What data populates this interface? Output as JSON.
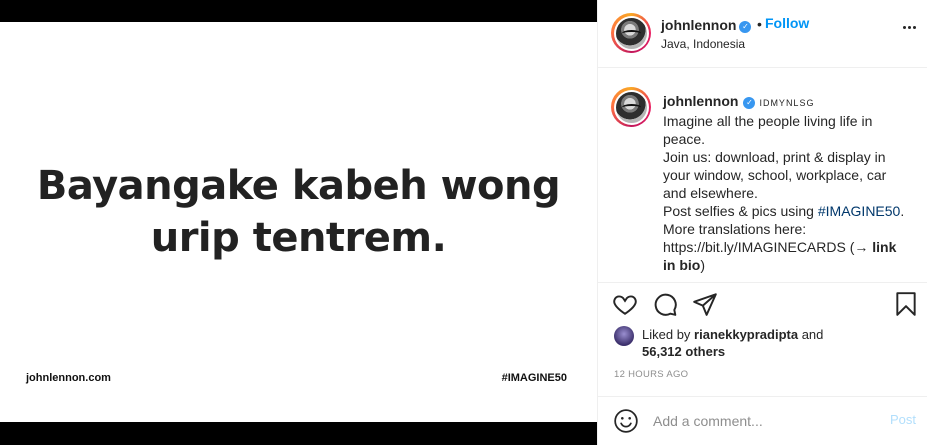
{
  "media": {
    "headline_line1": "Bayangake kabeh wong",
    "headline_line2": "urip tentrem.",
    "footer_left": "johnlennon.com",
    "footer_right": "#IMAGINE50"
  },
  "header": {
    "username": "johnlennon",
    "verified_icon": "verified-badge-icon",
    "separator": "•",
    "follow_label": "Follow",
    "location": "Java, Indonesia"
  },
  "caption": {
    "username": "johnlennon",
    "code": "IDMYNLSG",
    "line1": "Imagine all the people living life in",
    "line2": "peace.",
    "line3": "Join us: download, print & display in",
    "line4": "your window, school, workplace, car",
    "line5": "and elsewhere.",
    "line6_prefix": "Post selfies & pics using ",
    "line6_hashtag": "#IMAGINE50",
    "line6_suffix": ".",
    "line7": "More translations here:",
    "line8_prefix": "https://bit.ly/IMAGINECARDS (→ ",
    "line8_bold": "link",
    "line9_bold": "in bio",
    "line9_suffix": ")"
  },
  "likes": {
    "prefix": "Liked by ",
    "user": "rianekkypradipta",
    "suffix": " and",
    "count": "56,312 others"
  },
  "timestamp": "12 HOURS AGO",
  "comment": {
    "placeholder": "Add a comment...",
    "post_label": "Post"
  },
  "colors": {
    "accent": "#0095f6",
    "hashtag": "#00376b",
    "muted": "#8e8e8e",
    "post_disabled": "#b2dffc"
  },
  "icons": [
    "heart-icon",
    "comment-icon",
    "share-icon",
    "bookmark-icon",
    "emoji-icon",
    "more-icon",
    "verified-badge-icon"
  ]
}
